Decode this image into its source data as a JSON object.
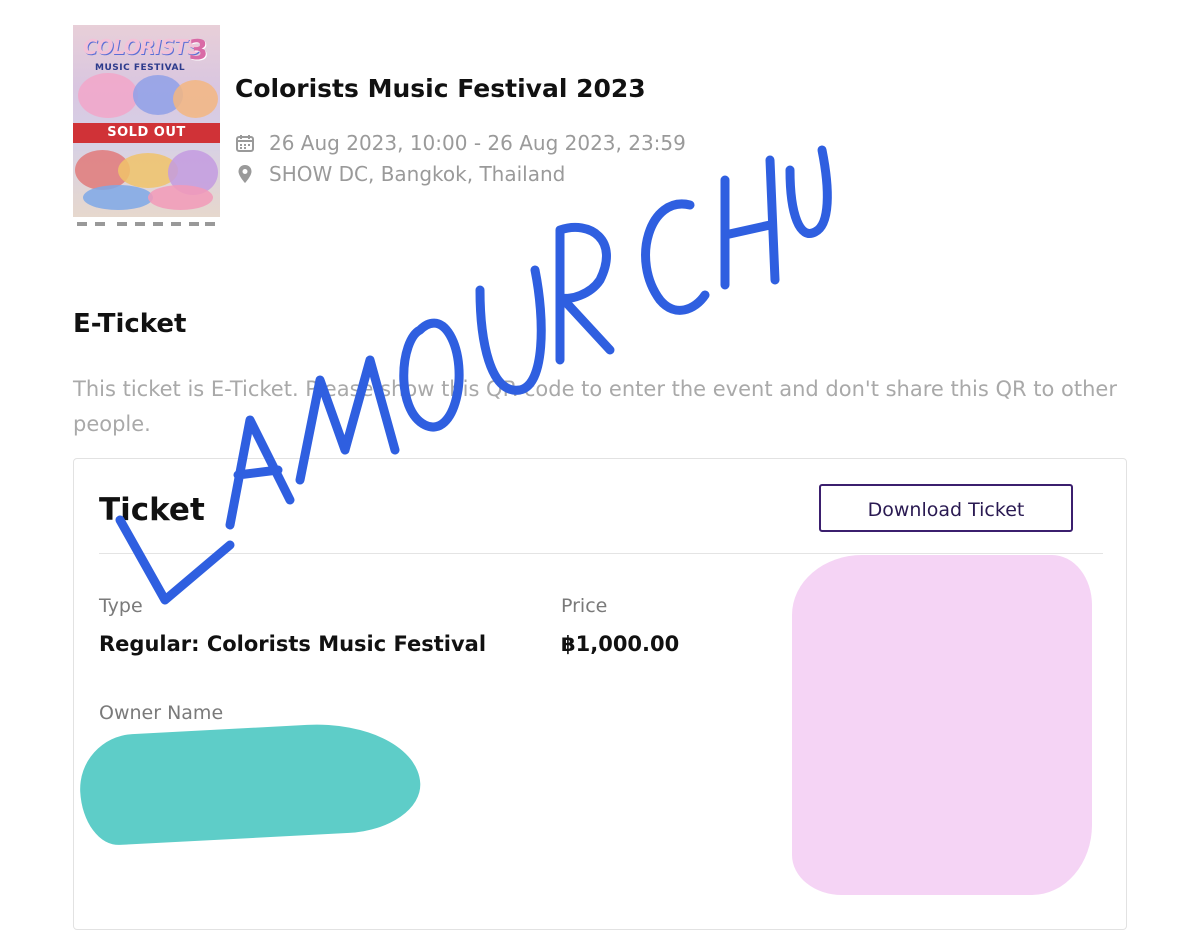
{
  "event": {
    "title": "Colorists Music Festival 2023",
    "datetime": "26 Aug 2023, 10:00 - 26 Aug 2023, 23:59",
    "location": "SHOW DC, Bangkok, Thailand",
    "calendar_icon": "calendar-icon",
    "location_icon": "map-pin-icon"
  },
  "poster": {
    "title_text": "COLORISTS",
    "edition": "3",
    "subtitle": "MUSIC FESTIVAL",
    "badge": "SOLD OUT"
  },
  "eticket": {
    "heading": "E-Ticket",
    "description": "This ticket is E-Ticket. Please show this QR code to enter the event and don't share this QR to other people."
  },
  "ticket": {
    "heading": "Ticket",
    "download_label": "Download Ticket",
    "type_label": "Type",
    "type_value": "Regular: Colorists Music Festival",
    "price_label": "Price",
    "price_value": "฿1,000.00",
    "owner_label": "Owner Name"
  },
  "overlay": {
    "handwritten_text": "LAMOURCHU",
    "colors": {
      "ink": "#2f5fe0",
      "name_redaction": "#5ecdc8",
      "qr_redaction": "#f5d4f5"
    }
  }
}
